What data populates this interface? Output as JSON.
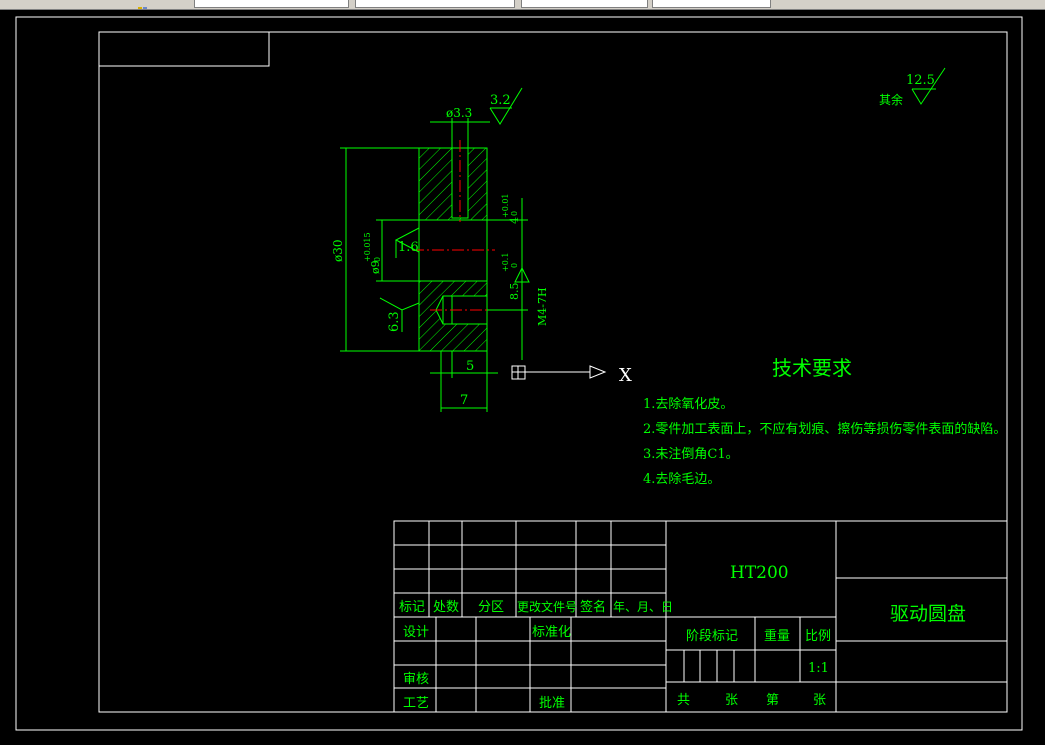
{
  "toolbar": {
    "tabs": [
      "",
      "",
      "",
      ""
    ]
  },
  "drawing": {
    "colors": {
      "background": "#000000",
      "frame": "#ffffff",
      "text": "#00ff00",
      "centerline": "#ff0000",
      "hatch": "#00ff00"
    },
    "roughness_general_label": "其余",
    "roughness_general_value": "12.5",
    "roughness_top": "3.2",
    "dim_bore_top": "ø3.3",
    "dim_diameter_outer": "ø30",
    "dim_diameter_hole": "ø9",
    "dim_diameter_hole_tol": "+0.015",
    "dim_diameter_hole_tol_low": "0",
    "roughness_left": "1.6",
    "dim_right_top": "4",
    "dim_right_top_tol": "+0.01",
    "dim_right_top_tol_low": "0",
    "dim_right_mid": "8.5",
    "dim_right_mid_tol": "+0.1",
    "dim_right_mid_tol_low": "0",
    "dim_thread": "M4-7H",
    "roughness_bottom_left": "6.3",
    "dim_width_5": "5",
    "dim_width_7": "7",
    "ucs_axis_label": "X"
  },
  "tech_requirements": {
    "title": "技术要求",
    "items": [
      "1.去除氧化皮。",
      "2.零件加工表面上，不应有划痕、擦伤等损伤零件表面的缺陷。",
      "3.未注倒角C1。",
      "4.去除毛边。"
    ]
  },
  "title_block": {
    "material": "HT200",
    "part_name": "驱动圆盘",
    "rev_headers": [
      "标记",
      "处数",
      "分区",
      "更改文件号",
      "签名",
      "年、月、日"
    ],
    "design": "设计",
    "standardize": "标准化",
    "review": "审核",
    "process": "工艺",
    "approve": "批准",
    "stage_mark": "阶段标记",
    "weight": "重量",
    "scale_label": "比例",
    "scale_value": "1:1",
    "total": "共",
    "sheets1": "张",
    "sheet_no": "第",
    "sheets2": "张"
  }
}
